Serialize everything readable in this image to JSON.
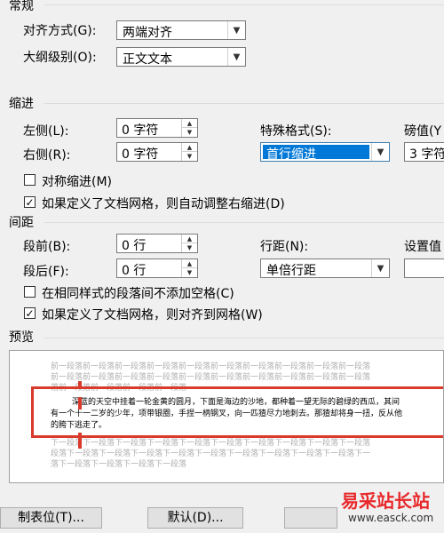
{
  "general": {
    "section_title": "常规",
    "alignment_label": "对齐方式(G):",
    "alignment_value": "两端对齐",
    "outline_label": "大纲级别(O):",
    "outline_value": "正文文本"
  },
  "indent": {
    "section_title": "缩进",
    "left_label": "左侧(L):",
    "left_value": "0 字符",
    "right_label": "右侧(R):",
    "right_value": "0 字符",
    "special_label": "特殊格式(S):",
    "special_value": "首行缩进",
    "by_label": "磅值(Y",
    "by_value": "3 字符",
    "mirror_label": "对称缩进(M)",
    "mirror_checked": false,
    "auto_adjust_label": "如果定义了文档网格，则自动调整右缩进(D)",
    "auto_adjust_checked": true
  },
  "spacing": {
    "section_title": "间距",
    "before_label": "段前(B):",
    "before_value": "0 行",
    "after_label": "段后(F):",
    "after_value": "0 行",
    "line_spacing_label": "行距(N):",
    "line_spacing_value": "单倍行距",
    "at_label": "设置值",
    "at_value": "",
    "no_space_label": "在相同样式的段落间不添加空格(C)",
    "no_space_checked": false,
    "snap_grid_label": "如果定义了文档网格，则对齐到网格(W)",
    "snap_grid_checked": true
  },
  "preview": {
    "section_title": "预览",
    "prev_para_1": "前一段落前一段落前一段落前一段落前一段落前一段落前一段落前一段落前一段落前一段落",
    "prev_para_2": "前一段落前一段落前一段落前一段落前一段落前一段落前一段落前一段落前一段落前一段落",
    "prev_para_3": "落前一段落前一段落前一段落前一段落",
    "body_1": "深蓝的天空中挂着一轮金黄的圆月，下面是海边的沙地，都种着一望无际的碧绿的西瓜，其间",
    "body_2": "有一个十一二岁的少年，项带银圈，手捏一柄钢叉，向一匹猹尽力地刺去。那猹却将身一扭，反从他",
    "body_3": "的胯下逃走了。",
    "next_para_1": "下一段落下一段落下一段落下一段落下一段落下一段落下一段落下一段落下一段落下一段落",
    "next_para_2": "段落下一段落下一段落下一段落下一段落下一段落下一段落下一段落下一段落下一段落下一",
    "next_para_3": "落下一段落下一段落下一段落下一段落"
  },
  "buttons": {
    "tabs_label": "制表位(T)...",
    "default_label": "默认(D)..."
  },
  "watermark": {
    "text": "易采站长站",
    "url": "www.easck.com"
  },
  "colors": {
    "accent": "#0078d7",
    "annotation": "#d93a2b"
  }
}
